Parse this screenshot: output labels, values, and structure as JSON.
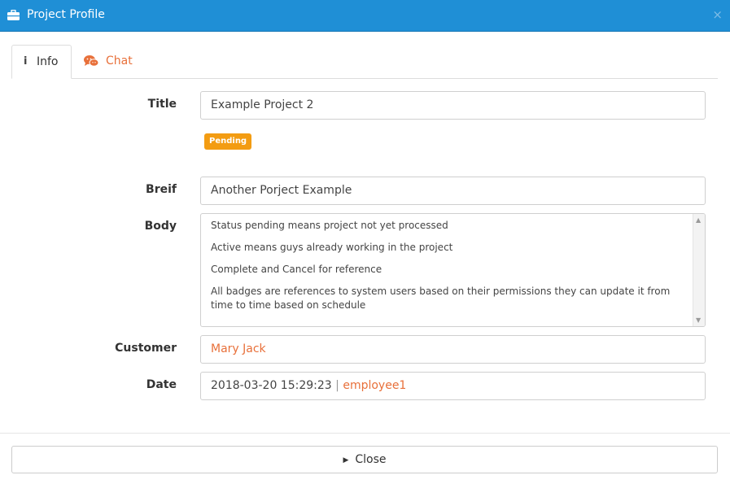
{
  "window": {
    "title": "Project Profile",
    "title_icon": "briefcase-icon",
    "close_symbol": "×"
  },
  "tabs": [
    {
      "label": "Info",
      "icon": "info-icon",
      "active": true
    },
    {
      "label": "Chat",
      "icon": "chat-bubbles-icon",
      "active": false
    }
  ],
  "form": {
    "title_label": "Title",
    "title_value": "Example Project 2",
    "status_badge": "Pending",
    "brief_label": "Breif",
    "brief_value": "Another Porject Example",
    "body_label": "Body",
    "body_paragraphs": [
      "Status pending means project not yet processed",
      "Active means guys already working in the project",
      "Complete and Cancel for reference",
      "All badges are references to system users based on their permissions they can update it from time to time based on  schedule"
    ],
    "customer_label": "Customer",
    "customer_value": "Mary Jack",
    "date_label": "Date",
    "date_value": "2018-03-20 15:29:23",
    "date_separator": "|",
    "date_user": "employee1"
  },
  "footer": {
    "close_label": "Close"
  },
  "colors": {
    "header_blue": "#1f8fd6",
    "accent_orange": "#e8703a",
    "badge_pending": "#f39c12"
  }
}
